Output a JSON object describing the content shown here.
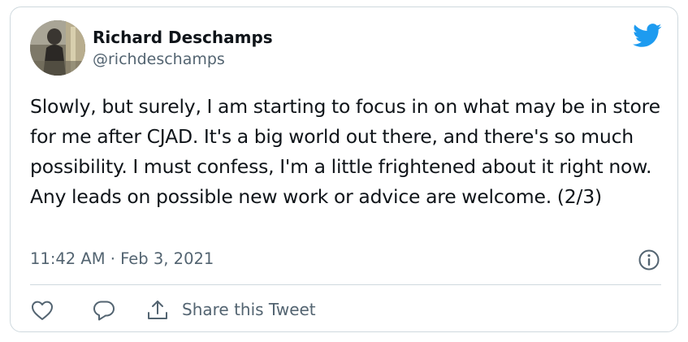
{
  "tweet": {
    "author_name": "Richard Deschamps",
    "author_handle": "@richdeschamps",
    "text": "Slowly, but surely, I am starting to focus in on what may be in store for me after CJAD. It's a big world out there, and there's so much possibility. I must confess, I'm a little frightened about it right now. Any leads on possible new work or advice are welcome. (2/3)",
    "timestamp": "11:42 AM · Feb 3, 2021"
  },
  "actions": {
    "share_label": "Share this Tweet"
  },
  "icons": {
    "brand": "twitter-bird-icon",
    "info": "info-icon",
    "like": "heart-icon",
    "reply": "reply-bubble-icon",
    "share": "share-upload-icon"
  },
  "colors": {
    "brand_blue": "#1d9bf0",
    "text_primary": "#0f1419",
    "text_secondary": "#536471",
    "border": "#cfd9de"
  }
}
